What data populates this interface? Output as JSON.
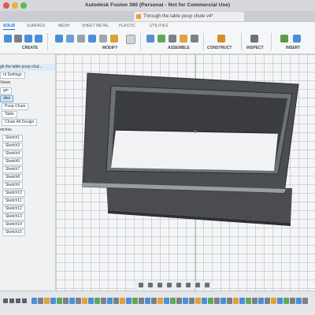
{
  "window": {
    "title": "Autodesk Fusion 360 (Personal - Not for Commercial Use)",
    "document_tab": "Through the table poop chute v4*"
  },
  "toolbar": {
    "tabs": [
      "SOLID",
      "SURFACE",
      "MESH",
      "SHEET METAL",
      "PLASTIC",
      "UTILITIES"
    ],
    "active_tab": "SOLID",
    "groups": {
      "create": "CREATE",
      "modify": "MODIFY",
      "assemble": "ASSEMBLE",
      "construct": "CONSTRUCT",
      "inspect": "INSPECT",
      "insert": "INSERT"
    }
  },
  "browser": {
    "items": [
      {
        "label": "gh the table poop chut...",
        "style": "selected"
      },
      {
        "label": "nt Settings",
        "style": "plain"
      },
      {
        "label": "Views",
        "style": "plain"
      },
      {
        "label": "gin",
        "style": "plain"
      },
      {
        "label": "dies",
        "style": "blue"
      },
      {
        "label": "Poop Chute",
        "style": "box"
      },
      {
        "label": "Table",
        "style": "box"
      },
      {
        "label": "Chute Alt Design",
        "style": "box"
      },
      {
        "label": "etches",
        "style": "plain"
      },
      {
        "label": "Sketch1",
        "style": "box"
      },
      {
        "label": "Sketch3",
        "style": "box"
      },
      {
        "label": "Sketch4",
        "style": "box"
      },
      {
        "label": "Sketch5",
        "style": "box"
      },
      {
        "label": "Sketch7",
        "style": "box"
      },
      {
        "label": "Sketch8",
        "style": "box"
      },
      {
        "label": "Sketch9",
        "style": "box"
      },
      {
        "label": "Sketch10",
        "style": "box"
      },
      {
        "label": "Sketch11",
        "style": "box"
      },
      {
        "label": "Sketch12",
        "style": "box"
      },
      {
        "label": "Sketch13",
        "style": "box"
      },
      {
        "label": "Sketch14",
        "style": "box"
      },
      {
        "label": "Sketch15",
        "style": "box"
      }
    ]
  },
  "colors": {
    "accent": "#1a6fd1",
    "model_dark": "#3d3f43",
    "model_mid": "#5b5e63",
    "model_light": "#8a8d92"
  }
}
